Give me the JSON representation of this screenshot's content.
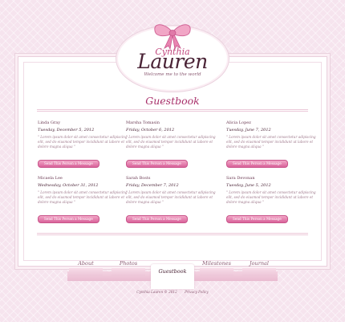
{
  "logo": {
    "script": "Cynthia",
    "main": "Lauren",
    "tagline": "Welcome me to the world"
  },
  "page_title": "Guestbook",
  "entries": [
    {
      "name": "Linda Gray",
      "date": "Tuesday, December 5, 2012",
      "text": "\" Lorem ipsum dolor sit amet consectetur adipiscing elit, sed do eiusmod tempor incididunt ut labore et dolore magna aliqua \"",
      "button": "Send This Person a Message"
    },
    {
      "name": "Marsha Tomasin",
      "date": "Friday, October 6, 2012",
      "text": "\" Lorem ipsum dolor sit amet consectetur adipiscing elit, sed do eiusmod tempor incididunt ut labore et dolore magna aliqua \"",
      "button": "Send This Person a Message"
    },
    {
      "name": "Alicia Lopez",
      "date": "Tuesday, June 7, 2012",
      "text": "\" Lorem ipsum dolor sit amet consectetur adipiscing elit, sed do eiusmod tempor incididunt ut labore et dolore magna aliqua \"",
      "button": "Send This Person a Message"
    },
    {
      "name": "Micaela Lee",
      "date": "Wednesday, October 31, 2012",
      "text": "\" Lorem ipsum dolor sit amet consectetur adipiscing elit, sed do eiusmod tempor incididunt ut labore et dolore magna aliqua \"",
      "button": "Send This Person a Message"
    },
    {
      "name": "Sarah Bosts",
      "date": "Friday, December 7, 2012",
      "text": "\" Lorem ipsum dolor sit amet consectetur adipiscing elit, sed do eiusmod tempor incididunt ut labore et dolore magna aliqua \"",
      "button": "Send This Person a Message"
    },
    {
      "name": "Sara Devonan",
      "date": "Tuesday, June 5, 2012",
      "text": "\" Lorem ipsum dolor sit amet consectetur adipiscing elit, sed do eiusmod tempor incididunt ut labore et dolore magna aliqua \"",
      "button": "Send This Person a Message"
    }
  ],
  "nav": {
    "about": "About",
    "photos": "Photos",
    "guestbook": "Guestbook",
    "milestones": "Milestones",
    "journal": "Journal"
  },
  "footer": {
    "copyright": "Cynthia Lauren © 2012",
    "privacy": "Privacy Policy"
  },
  "colors": {
    "accent": "#a8306a",
    "button": "#d8629a",
    "background": "#f6e4ee"
  }
}
